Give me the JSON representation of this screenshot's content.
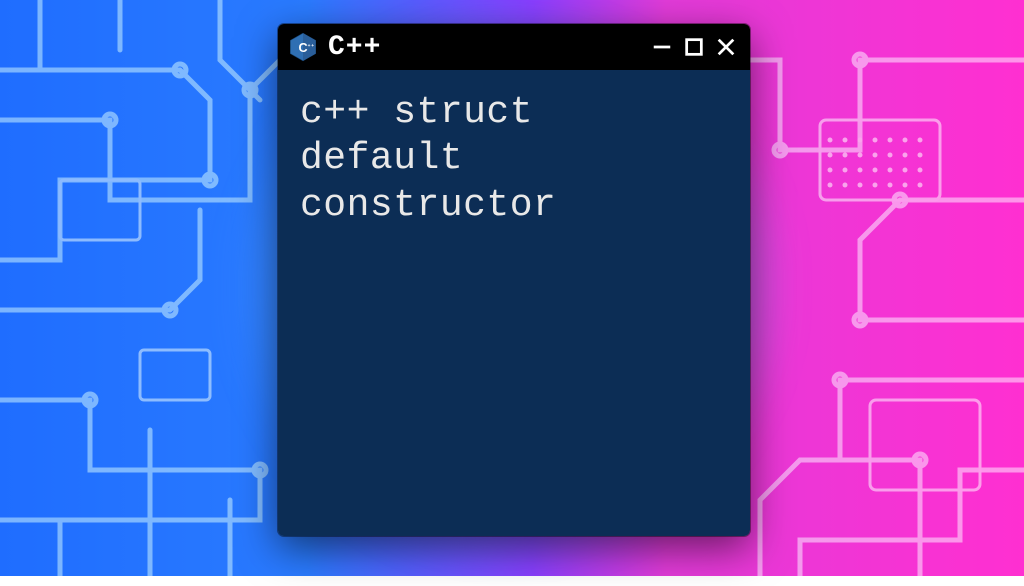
{
  "window": {
    "title": "C++",
    "icon_name": "cpp-language-icon",
    "content": "c++ struct\ndefault\nconstructor"
  },
  "colors": {
    "titlebar": "#000000",
    "terminal_bg": "#0c2d55",
    "text": "#e8e8e8"
  }
}
